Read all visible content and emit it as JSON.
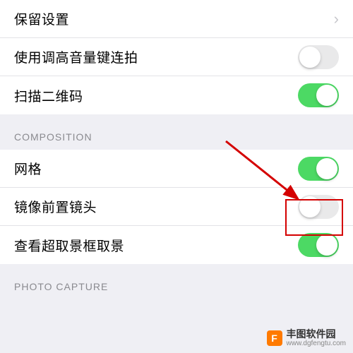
{
  "group1": {
    "preserve_settings": {
      "label": "保留设置"
    },
    "burst_volume_up": {
      "label": "使用调高音量键连拍",
      "on": false
    },
    "scan_qr": {
      "label": "扫描二维码",
      "on": true
    }
  },
  "composition": {
    "header": "COMPOSITION",
    "grid": {
      "label": "网格",
      "on": true
    },
    "mirror_front": {
      "label": "镜像前置镜头",
      "on": false
    },
    "outside_frame": {
      "label": "查看超取景框取景",
      "on": true
    }
  },
  "photo_capture": {
    "header": "PHOTO CAPTURE"
  },
  "annotation": {
    "highlight_target": "mirror_front_toggle",
    "arrow_color": "#d40000"
  },
  "watermark": {
    "name": "丰图软件园",
    "url": "www.dgfengtu.com"
  }
}
